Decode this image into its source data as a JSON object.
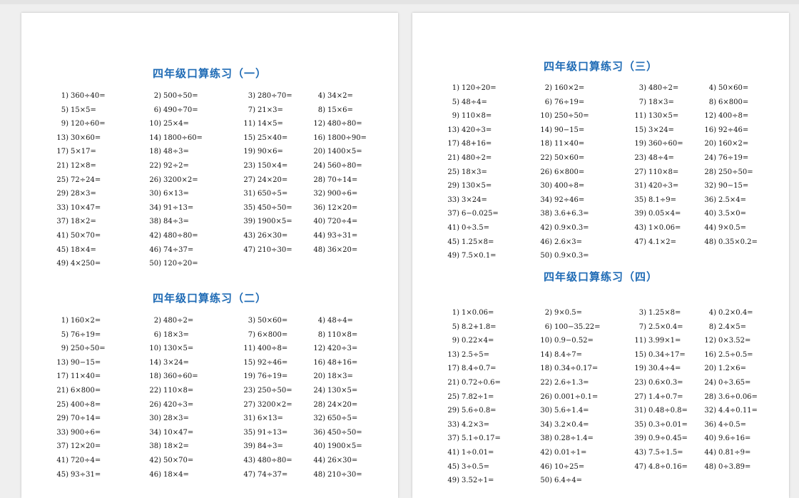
{
  "doc": {
    "pages": [
      {
        "sections": [
          {
            "title": "四年级口算练习（一）",
            "problems": [
              [
                "1)",
                "360÷40="
              ],
              [
                "2)",
                "500÷50="
              ],
              [
                "3)",
                "280÷70="
              ],
              [
                "4)",
                "34×2="
              ],
              [
                "5)",
                "15×5="
              ],
              [
                "6)",
                "490÷70="
              ],
              [
                "7)",
                "21×3="
              ],
              [
                "8)",
                "15×6="
              ],
              [
                "9)",
                "120÷60="
              ],
              [
                "10)",
                "25×4="
              ],
              [
                "11)",
                "14×5="
              ],
              [
                "12)",
                "480÷80="
              ],
              [
                "13)",
                "30×60="
              ],
              [
                "14)",
                "1800÷60="
              ],
              [
                "15)",
                "25×40="
              ],
              [
                "16)",
                "1800÷90="
              ],
              [
                "17)",
                "5×17="
              ],
              [
                "18)",
                "48÷3="
              ],
              [
                "19)",
                "90×6="
              ],
              [
                "20)",
                "1400×5="
              ],
              [
                "21)",
                "12×8="
              ],
              [
                "22)",
                "92÷2="
              ],
              [
                "23)",
                "150×4="
              ],
              [
                "24)",
                "560÷80="
              ],
              [
                "25)",
                "72÷24="
              ],
              [
                "26)",
                "3200×2="
              ],
              [
                "27)",
                "24×20="
              ],
              [
                "28)",
                "70÷14="
              ],
              [
                "29)",
                "28×3="
              ],
              [
                "30)",
                "6×13="
              ],
              [
                "31)",
                "650÷5="
              ],
              [
                "32)",
                "900÷6="
              ],
              [
                "33)",
                "10×47="
              ],
              [
                "34)",
                "91÷13="
              ],
              [
                "35)",
                "450÷50="
              ],
              [
                "36)",
                "12×20="
              ],
              [
                "37)",
                "18×2="
              ],
              [
                "38)",
                "84÷3="
              ],
              [
                "39)",
                "1900×5="
              ],
              [
                "40)",
                "720÷4="
              ],
              [
                "41)",
                "50×70="
              ],
              [
                "42)",
                "480÷80="
              ],
              [
                "43)",
                "26×30="
              ],
              [
                "44)",
                "93÷31="
              ],
              [
                "45)",
                "18×4="
              ],
              [
                "46)",
                "74÷37="
              ],
              [
                "47)",
                "210÷30="
              ],
              [
                "48)",
                "36×20="
              ],
              [
                "49)",
                "4×250="
              ],
              [
                "50)",
                "120÷20="
              ]
            ]
          },
          {
            "title": "四年级口算练习（二）",
            "problems": [
              [
                "1)",
                "160×2="
              ],
              [
                "2)",
                "480÷2="
              ],
              [
                "3)",
                "50×60="
              ],
              [
                "4)",
                "48÷4="
              ],
              [
                "5)",
                "76÷19="
              ],
              [
                "6)",
                "18×3="
              ],
              [
                "7)",
                "6×800="
              ],
              [
                "8)",
                "110×8="
              ],
              [
                "9)",
                "250÷50="
              ],
              [
                "10)",
                "130×5="
              ],
              [
                "11)",
                "400÷8="
              ],
              [
                "12)",
                "420÷3="
              ],
              [
                "13)",
                "90−15="
              ],
              [
                "14)",
                "3×24="
              ],
              [
                "15)",
                "92÷46="
              ],
              [
                "16)",
                "48+16="
              ],
              [
                "17)",
                "11×40="
              ],
              [
                "18)",
                "360÷60="
              ],
              [
                "19)",
                "76÷19="
              ],
              [
                "20)",
                "18×3="
              ],
              [
                "21)",
                "6×800="
              ],
              [
                "22)",
                "110×8="
              ],
              [
                "23)",
                "250÷50="
              ],
              [
                "24)",
                "130×5="
              ],
              [
                "25)",
                "400÷8="
              ],
              [
                "26)",
                "420÷3="
              ],
              [
                "27)",
                "3200×2="
              ],
              [
                "28)",
                "24×20="
              ],
              [
                "29)",
                "70÷14="
              ],
              [
                "30)",
                "28×3="
              ],
              [
                "31)",
                "6×13="
              ],
              [
                "32)",
                "650÷5="
              ],
              [
                "33)",
                "900÷6="
              ],
              [
                "34)",
                "10×47="
              ],
              [
                "35)",
                "91÷13="
              ],
              [
                "36)",
                "450÷50="
              ],
              [
                "37)",
                "12×20="
              ],
              [
                "38)",
                "18×2="
              ],
              [
                "39)",
                "84÷3="
              ],
              [
                "40)",
                "1900×5="
              ],
              [
                "41)",
                "720÷4="
              ],
              [
                "42)",
                "50×70="
              ],
              [
                "43)",
                "480÷80="
              ],
              [
                "44)",
                "26×30="
              ],
              [
                "45)",
                "93÷31="
              ],
              [
                "46)",
                "18×4="
              ],
              [
                "47)",
                "74÷37="
              ],
              [
                "48)",
                "210÷30="
              ]
            ]
          }
        ]
      },
      {
        "sections": [
          {
            "title": "四年级口算练习（三）",
            "problems": [
              [
                "1)",
                "120÷20="
              ],
              [
                "2)",
                "160×2="
              ],
              [
                "3)",
                "480÷2="
              ],
              [
                "4)",
                "50×60="
              ],
              [
                "5)",
                "48÷4="
              ],
              [
                "6)",
                "76÷19="
              ],
              [
                "7)",
                "18×3="
              ],
              [
                "8)",
                "6×800="
              ],
              [
                "9)",
                "110×8="
              ],
              [
                "10)",
                "250÷50="
              ],
              [
                "11)",
                "130×5="
              ],
              [
                "12)",
                "400÷8="
              ],
              [
                "13)",
                "420÷3="
              ],
              [
                "14)",
                "90−15="
              ],
              [
                "15)",
                "3×24="
              ],
              [
                "16)",
                "92÷46="
              ],
              [
                "17)",
                "48+16="
              ],
              [
                "18)",
                "11×40="
              ],
              [
                "19)",
                "360÷60="
              ],
              [
                "20)",
                "160×2="
              ],
              [
                "21)",
                "480÷2="
              ],
              [
                "22)",
                "50×60="
              ],
              [
                "23)",
                "48÷4="
              ],
              [
                "24)",
                "76÷19="
              ],
              [
                "25)",
                "18×3="
              ],
              [
                "26)",
                "6×800="
              ],
              [
                "27)",
                "110×8="
              ],
              [
                "28)",
                "250÷50="
              ],
              [
                "29)",
                "130×5="
              ],
              [
                "30)",
                "400÷8="
              ],
              [
                "31)",
                "420÷3="
              ],
              [
                "32)",
                "90−15="
              ],
              [
                "33)",
                "3×24="
              ],
              [
                "34)",
                "92÷46="
              ],
              [
                "35)",
                "8.1÷9="
              ],
              [
                "36)",
                "2.5×4="
              ],
              [
                "37)",
                "6−0.025="
              ],
              [
                "38)",
                "3.6+6.3="
              ],
              [
                "39)",
                "0.05×4="
              ],
              [
                "40)",
                "3.5×0="
              ],
              [
                "41)",
                "0÷3.5="
              ],
              [
                "42)",
                "0.9×0.3="
              ],
              [
                "43)",
                "1×0.06="
              ],
              [
                "44)",
                "9×0.5="
              ],
              [
                "45)",
                "1.25×8="
              ],
              [
                "46)",
                "2.6×3="
              ],
              [
                "47)",
                "4.1×2="
              ],
              [
                "48)",
                "0.35×0.2="
              ],
              [
                "49)",
                "7.5×0.1="
              ],
              [
                "50)",
                "0.9×0.3="
              ]
            ]
          },
          {
            "title": "四年级口算练习（四）",
            "problems": [
              [
                "1)",
                "1×0.06="
              ],
              [
                "2)",
                "9×0.5="
              ],
              [
                "3)",
                "1.25×8="
              ],
              [
                "4)",
                "0.2×0.4="
              ],
              [
                "5)",
                "8.2+1.8="
              ],
              [
                "6)",
                "100−35.22="
              ],
              [
                "7)",
                "2.5×0.4="
              ],
              [
                "8)",
                "2.4×5="
              ],
              [
                "9)",
                "0.22×4="
              ],
              [
                "10)",
                "0.9−0.52="
              ],
              [
                "11)",
                "3.99×1="
              ],
              [
                "12)",
                "0×3.52="
              ],
              [
                "13)",
                "2.5÷5="
              ],
              [
                "14)",
                "8.4÷7="
              ],
              [
                "15)",
                "0.34÷17="
              ],
              [
                "16)",
                "2.5÷0.5="
              ],
              [
                "17)",
                "8.4÷0.7="
              ],
              [
                "18)",
                "0.34÷0.17="
              ],
              [
                "19)",
                "30.4÷4="
              ],
              [
                "20)",
                "1.2×6="
              ],
              [
                "21)",
                "0.72÷0.6="
              ],
              [
                "22)",
                "2.6÷1.3="
              ],
              [
                "23)",
                "0.6×0.3="
              ],
              [
                "24)",
                "0÷3.65="
              ],
              [
                "25)",
                "7.82÷1="
              ],
              [
                "26)",
                "0.001÷0.1="
              ],
              [
                "27)",
                "1.4÷0.7="
              ],
              [
                "28)",
                "3.6÷0.06="
              ],
              [
                "29)",
                "5.6÷0.8="
              ],
              [
                "30)",
                "5.6÷1.4="
              ],
              [
                "31)",
                "0.48÷0.8="
              ],
              [
                "32)",
                "4.4÷0.11="
              ],
              [
                "33)",
                "4.2×3="
              ],
              [
                "34)",
                "3.2×0.4="
              ],
              [
                "35)",
                "0.3÷0.01="
              ],
              [
                "36)",
                "4÷0.5="
              ],
              [
                "37)",
                "5.1÷0.17="
              ],
              [
                "38)",
                "0.28÷1.4="
              ],
              [
                "39)",
                "0.9÷0.45="
              ],
              [
                "40)",
                "9.6÷16="
              ],
              [
                "41)",
                "1÷0.01="
              ],
              [
                "42)",
                "0.01÷1="
              ],
              [
                "43)",
                "7.5÷1.5="
              ],
              [
                "44)",
                "0.81÷9="
              ],
              [
                "45)",
                "3÷0.5="
              ],
              [
                "46)",
                "10÷25="
              ],
              [
                "47)",
                "4.8÷0.16="
              ],
              [
                "48)",
                "0÷3.89="
              ],
              [
                "49)",
                "3.52÷1="
              ],
              [
                "50)",
                "6.4÷4="
              ]
            ]
          }
        ]
      }
    ]
  }
}
